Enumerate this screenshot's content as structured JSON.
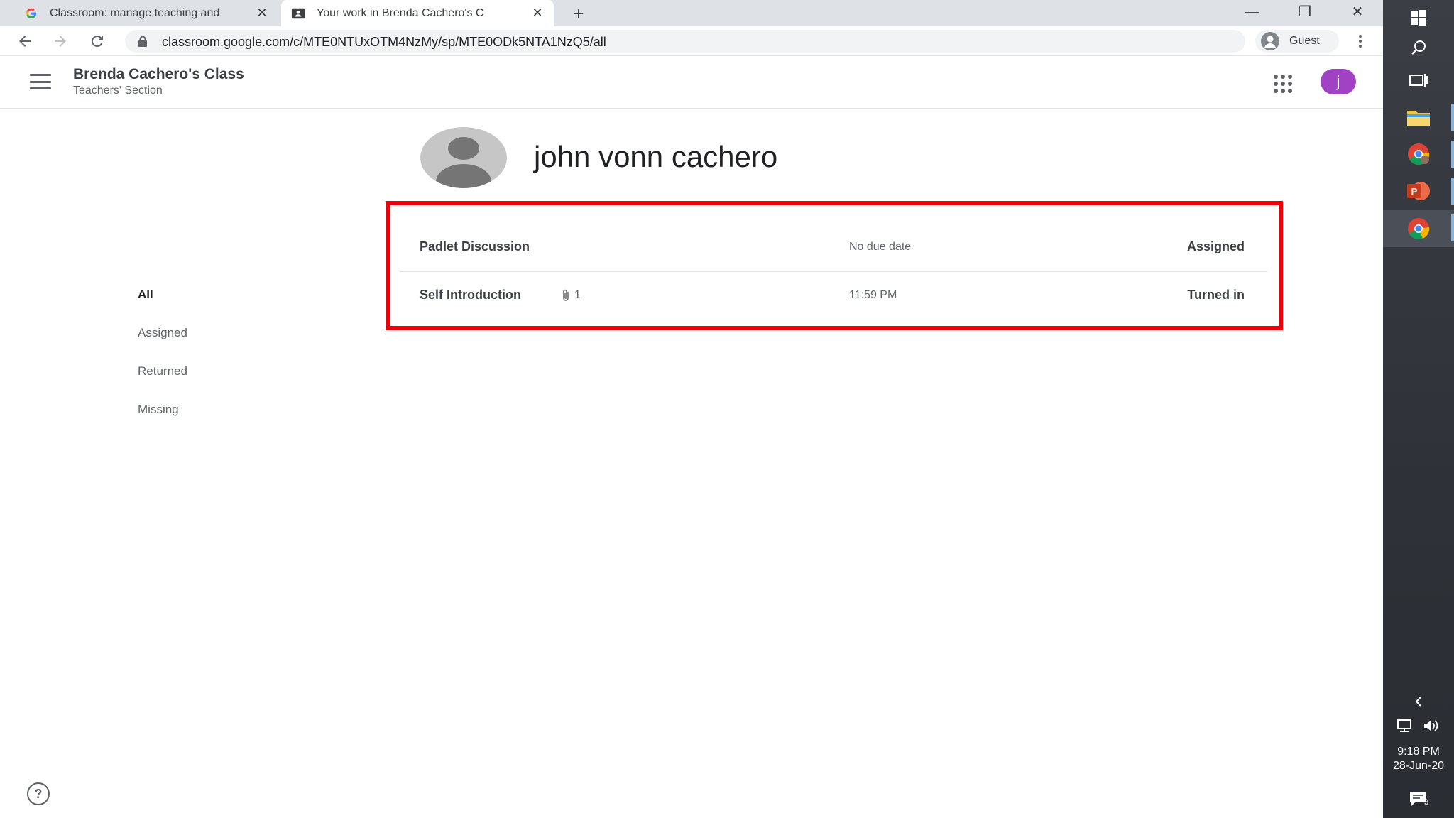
{
  "browser": {
    "tabs": [
      {
        "title": "Classroom: manage teaching and",
        "favicon": "google-g-icon"
      },
      {
        "title": "Your work in Brenda Cachero's C",
        "favicon": "classroom-icon"
      }
    ],
    "url": "classroom.google.com/c/MTE0NTUxOTM4NzMy/sp/MTE0ODk5NTA1NzQ5/all",
    "profile": "Guest"
  },
  "header": {
    "class_name": "Brenda Cachero's Class",
    "section": "Teachers' Section",
    "avatar_letter": "j",
    "avatar_color": "#a142c4"
  },
  "student": {
    "name": "john vonn cachero"
  },
  "filters": [
    {
      "label": "All",
      "selected": true
    },
    {
      "label": "Assigned",
      "selected": false
    },
    {
      "label": "Returned",
      "selected": false
    },
    {
      "label": "Missing",
      "selected": false
    }
  ],
  "work": [
    {
      "title": "Padlet Discussion",
      "attachments": "",
      "due": "No due date",
      "status": "Assigned"
    },
    {
      "title": "Self Introduction",
      "attachments": "1",
      "due": "11:59 PM",
      "status": "Turned in"
    }
  ],
  "highlight_color": "#e8000b",
  "taskbar": {
    "time": "9:18 PM",
    "date": "28-Jun-20",
    "notifications": "3"
  }
}
